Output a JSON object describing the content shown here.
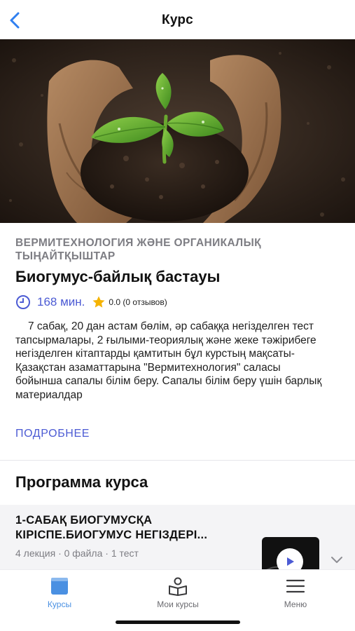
{
  "header": {
    "title": "Курс",
    "back_icon": "chevron-left-icon"
  },
  "colors": {
    "accent": "#4c5bd4",
    "tab_active": "#4a90e2",
    "star": "#f5b301",
    "muted": "#7d7d83"
  },
  "course": {
    "category": "ВЕРМИТЕХНОЛОГИЯ ЖӘНЕ ОРГАНИКАЛЫҚ ТЫҢАЙТҚЫШТАР",
    "title": "Биогумус-байлық бастауы",
    "duration": "168 мин.",
    "rating": "0.0 (0 отзывов)",
    "description": "7 сабақ, 20 дан астам бөлім, әр сабаққа негізделген тест тапсырмалары, 2 ғылыми-теориялық және жеке тәжірибеге негізделген кітаптарды қамтитын бұл курстың мақсаты- Қазақстан азаматтарына \"Вермитехнология\" саласы бойынша сапалы білім беру. Сапалы білім беру үшін барлық материалдар",
    "more_label": "ПОДРОБНЕЕ"
  },
  "program": {
    "title": "Программа курса",
    "lessons": [
      {
        "title": "1-САБАҚ БИОГУМУСҚА КІРІСПЕ.БИОГУМУС НЕГІЗДЕРІ...",
        "meta": "4 лекция · 0 файла · 1 тест"
      }
    ]
  },
  "tabbar": {
    "items": [
      {
        "label": "Курсы",
        "icon": "book-icon",
        "active": true
      },
      {
        "label": "Мои курсы",
        "icon": "reader-icon",
        "active": false
      },
      {
        "label": "Меню",
        "icon": "hamburger-icon",
        "active": false
      }
    ]
  }
}
